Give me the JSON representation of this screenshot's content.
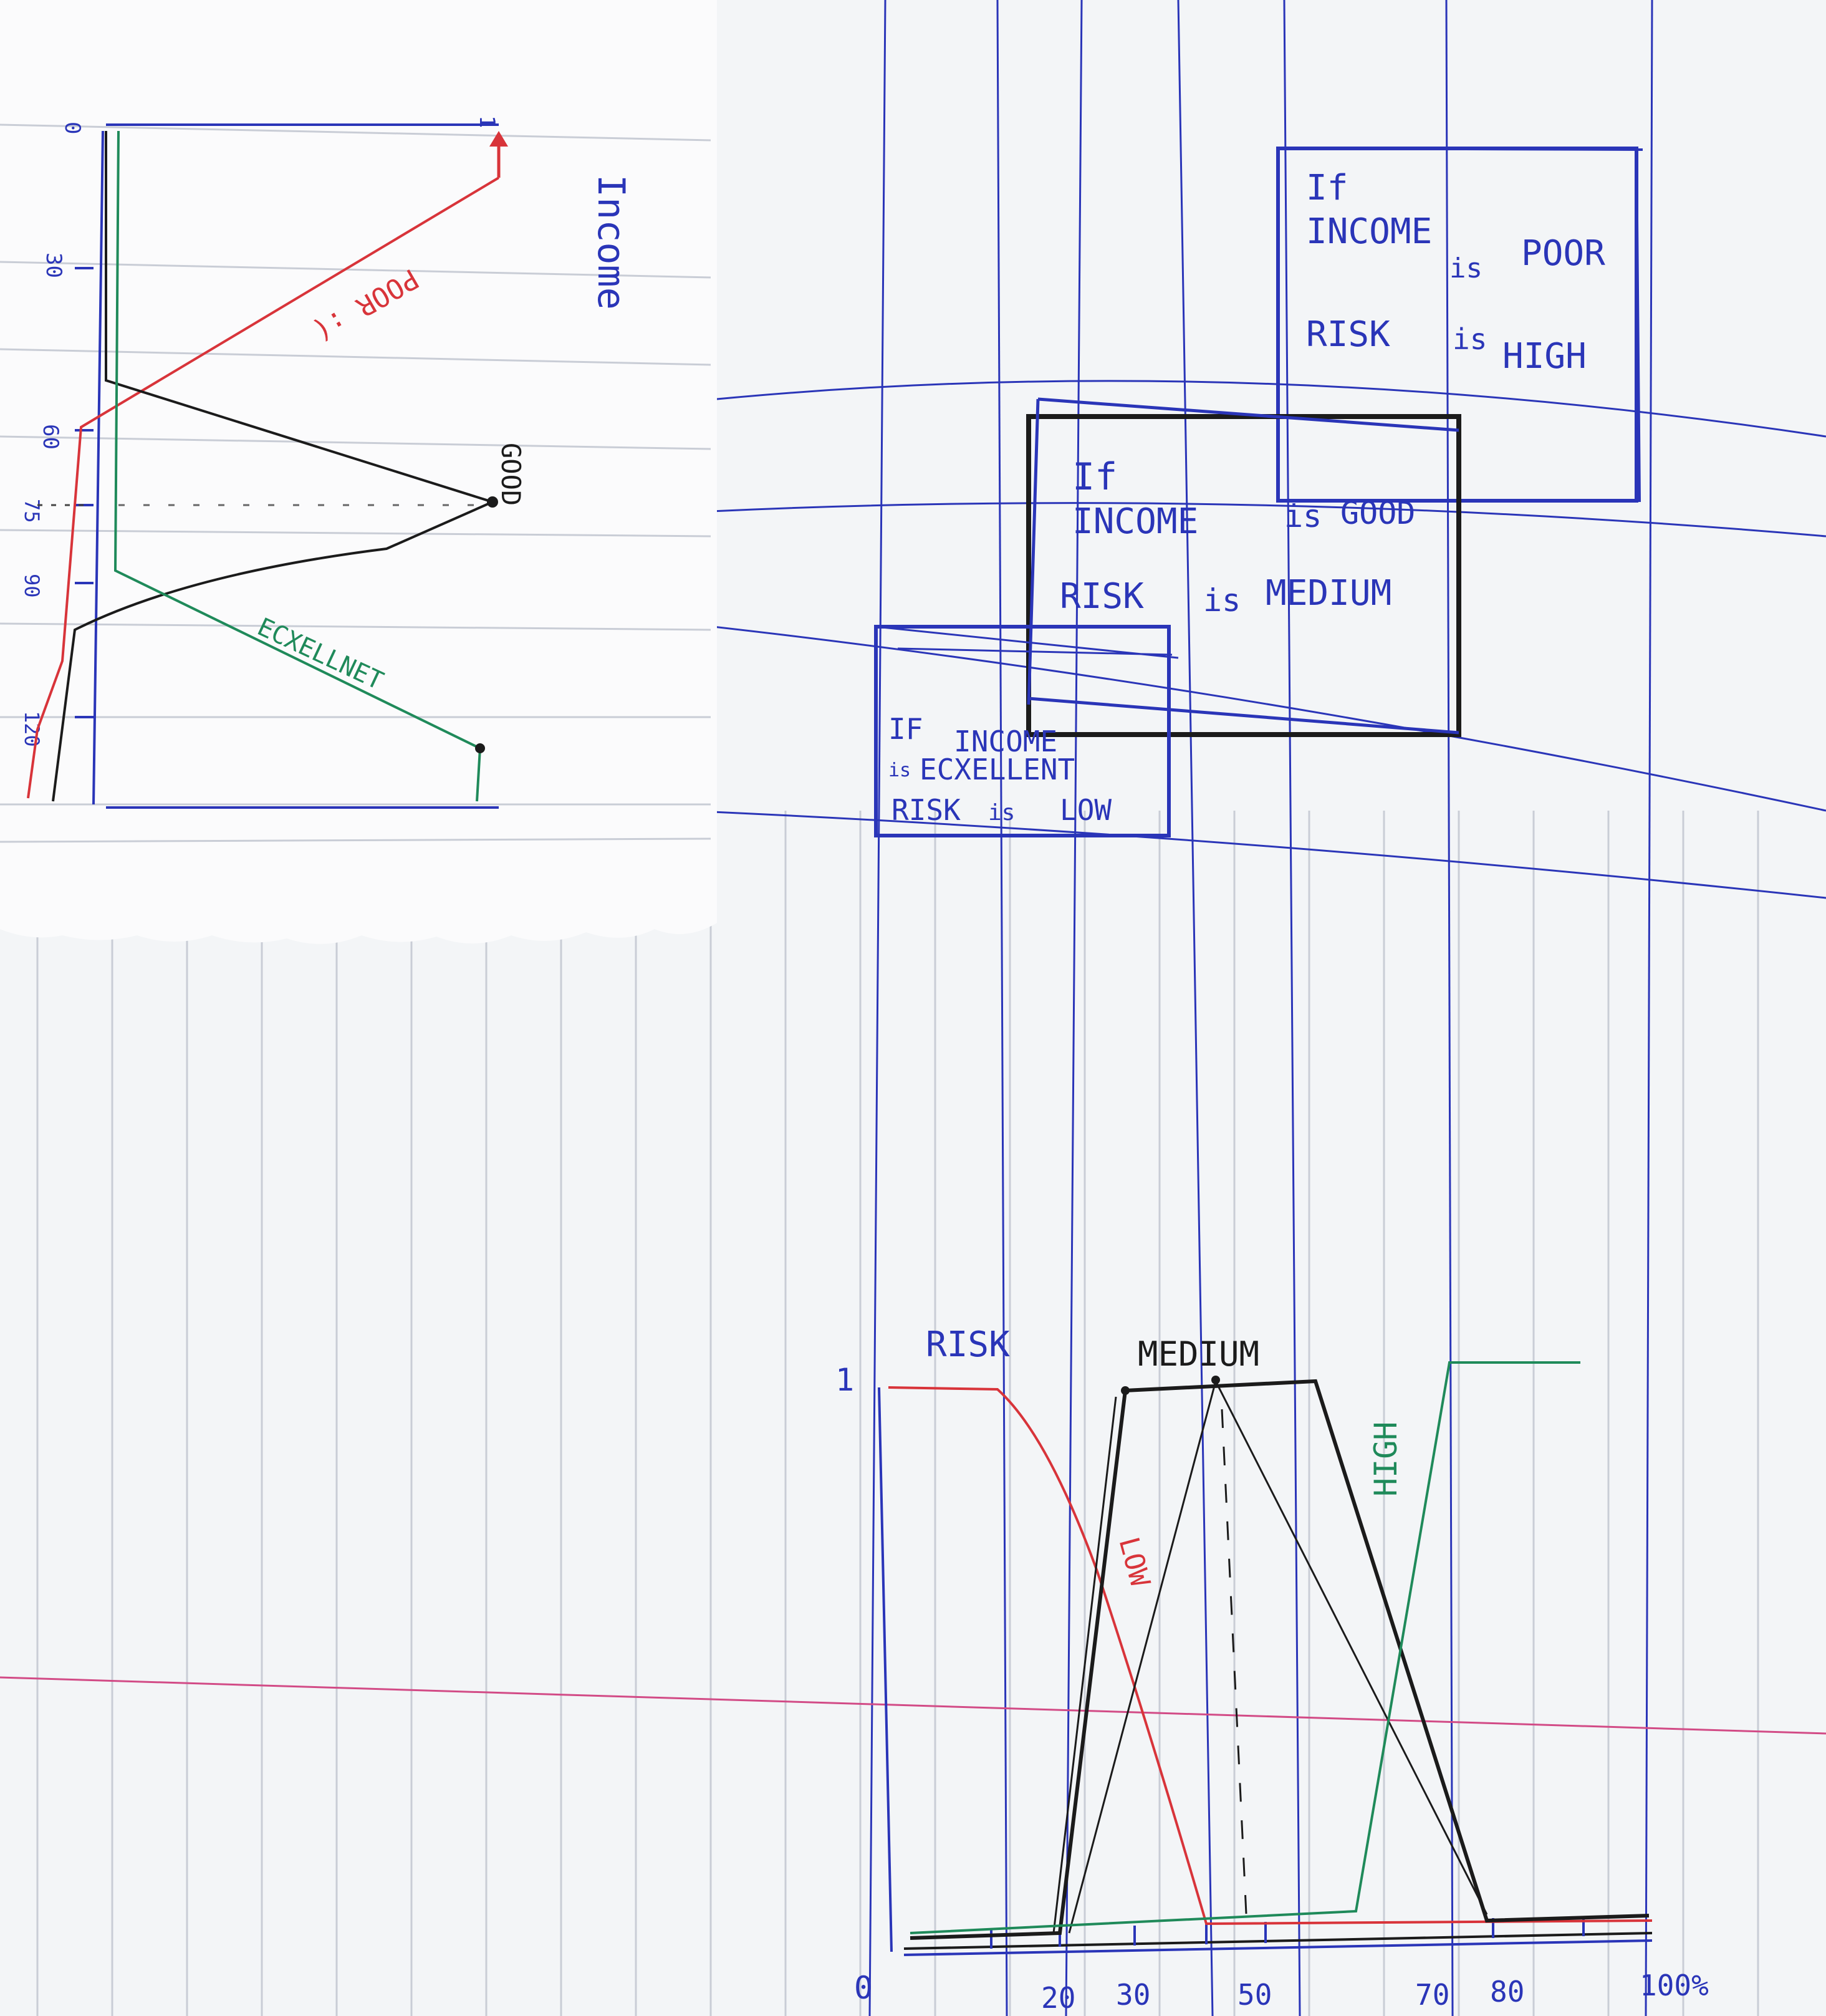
{
  "income_chart": {
    "title": "Income",
    "ticks": [
      "0",
      "30",
      "60",
      "75",
      "90",
      "120"
    ],
    "top_tick": "1",
    "curves": {
      "poor": "POOR :(",
      "good": "GOOD",
      "excellent": "ECXELLNET"
    },
    "colors": {
      "poor": "#d8343a",
      "good": "#1b1b1b",
      "excellent": "#1f8a5a"
    }
  },
  "rules": [
    {
      "lines": [
        "If",
        "INCOME",
        "is",
        "POOR",
        "RISK",
        "is",
        "HIGH"
      ]
    },
    {
      "lines": [
        "If",
        "INCOME",
        "is",
        "GOOD",
        "RISK",
        "is",
        "MEDIUM"
      ]
    },
    {
      "lines": [
        "IF",
        "INCOME",
        "is",
        "ECXELLENT",
        "RISK",
        "is",
        "LOW"
      ]
    }
  ],
  "risk_chart": {
    "title": "RISK",
    "y_tick_top": "1",
    "y_tick_zero": "0",
    "x_ticks": [
      "20",
      "30",
      "50",
      "70",
      "80",
      "100%"
    ],
    "labels": {
      "low": "LOW",
      "medium": "MEDIUM",
      "high": "HIGH"
    },
    "colors": {
      "low": "#d8343a",
      "medium": "#1b1b1b",
      "high": "#1f8a5a"
    }
  },
  "paper": {
    "line_color": "#2a35b8",
    "margin_color": "#d24b86",
    "ruled_color": "#c9cdd6"
  }
}
